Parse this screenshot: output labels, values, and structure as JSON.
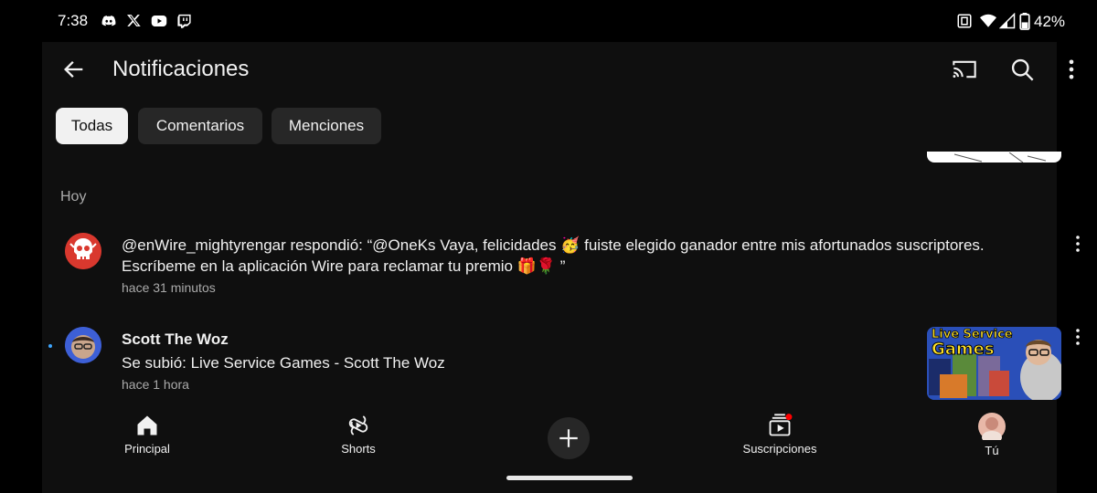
{
  "status_bar": {
    "time": "7:38",
    "battery": "42%",
    "app_icons": [
      "discord-icon",
      "x-icon",
      "youtube-icon",
      "twitch-icon"
    ]
  },
  "header": {
    "title": "Notificaciones"
  },
  "chips": [
    {
      "label": "Todas",
      "selected": true
    },
    {
      "label": "Comentarios",
      "selected": false
    },
    {
      "label": "Menciones",
      "selected": false
    }
  ],
  "section": {
    "label": "Hoy"
  },
  "notifications": [
    {
      "text_line1": "@enWire_mightyrengar respondió: “@OneKs Vaya, felicidades 🥳 fuiste elegido ganador entre mis afortunados suscriptores.",
      "text_line2": "Escríbeme en la aplicación Wire para reclamar tu premio 🎁🌹 ”",
      "time": "hace 31 minutos"
    },
    {
      "channel": "Scott The Woz",
      "text": "Se subió: Live Service Games - Scott The Woz",
      "time": "hace 1 hora",
      "thumbnail_title_line1": "Live Service",
      "thumbnail_title_line2": "Games",
      "unread": true
    }
  ],
  "bottom_nav": {
    "items": [
      {
        "label": "Principal",
        "icon": "home-icon"
      },
      {
        "label": "Shorts",
        "icon": "shorts-icon"
      },
      {
        "label": "Suscripciones",
        "icon": "subscriptions-icon"
      },
      {
        "label": "Tú",
        "icon": "avatar"
      }
    ]
  },
  "colors": {
    "background": "#0f0f0f",
    "chip_bg": "#272727",
    "chip_active_bg": "#f1f1f1",
    "secondary_text": "#aaaaaa",
    "unread_dot": "#3ea6ff",
    "notification_badge": "#ff0000"
  }
}
